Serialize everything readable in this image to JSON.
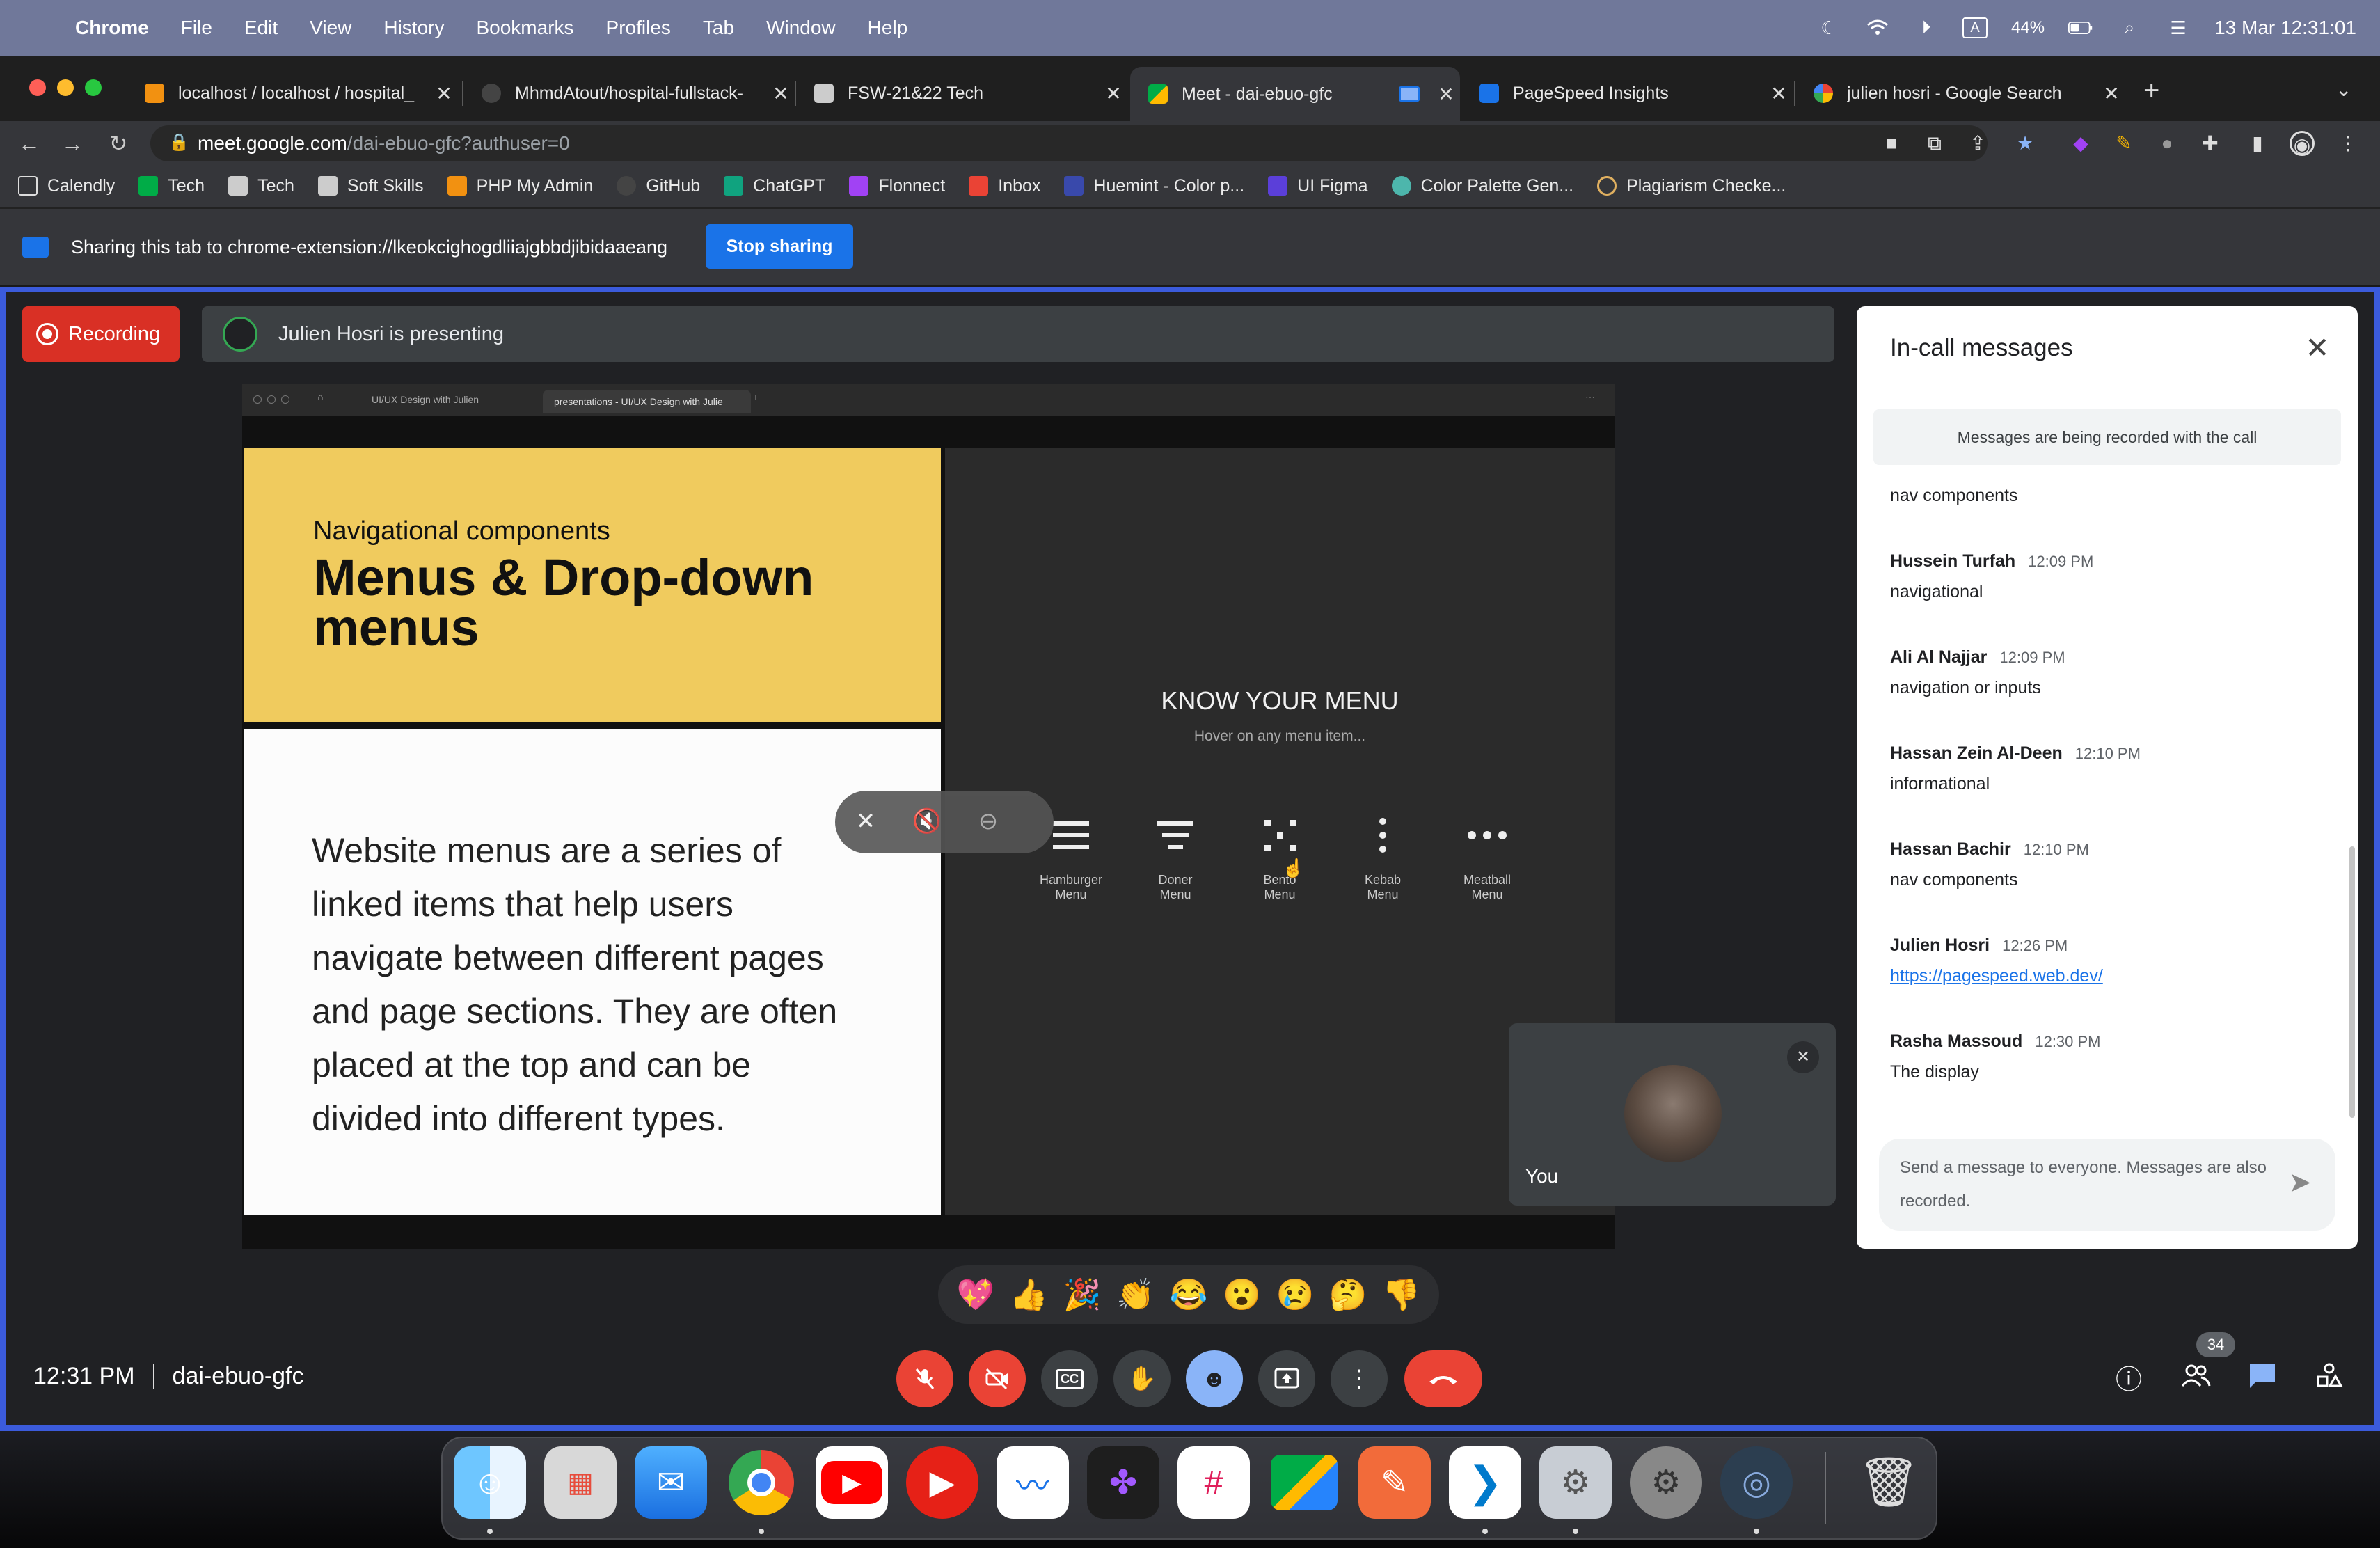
{
  "menubar": {
    "app": "Chrome",
    "items": [
      "File",
      "Edit",
      "View",
      "History",
      "Bookmarks",
      "Profiles",
      "Tab",
      "Window",
      "Help"
    ],
    "battery": "44%",
    "datetime": "13 Mar  12:31:01"
  },
  "tabs": [
    {
      "title": "localhost / localhost / hospital_"
    },
    {
      "title": "MhmdAtout/hospital-fullstack-"
    },
    {
      "title": "FSW-21&22 Tech"
    },
    {
      "title": "Meet - dai-ebuo-gfc"
    },
    {
      "title": "PageSpeed Insights"
    },
    {
      "title": "julien hosri - Google Search"
    }
  ],
  "omnibox": {
    "host": "meet.google.com",
    "path": "/dai-ebuo-gfc?authuser=0"
  },
  "bookmarks": [
    "Calendly",
    "Tech",
    "Tech",
    "Soft Skills",
    "PHP My Admin",
    "GitHub",
    "ChatGPT",
    "Flonnect",
    "Inbox",
    "Huemint - Color p...",
    "UI Figma",
    "Color Palette Gen...",
    "Plagiarism Checke..."
  ],
  "sharebar": {
    "text": "Sharing this tab to chrome-extension://lkeokcighogdliiajgbbdjibidaaeang",
    "stop": "Stop sharing"
  },
  "meet": {
    "recording": "Recording",
    "presenting": "Julien Hosri is presenting",
    "time": "12:31 PM",
    "code": "dai-ebuo-gfc",
    "self_label": "You",
    "participants": "34"
  },
  "slide": {
    "inner_tabs": [
      "UI/UX Design with Julien",
      "presentations - UI/UX Design with Julie"
    ],
    "kicker": "Navigational components",
    "title": "Menus & Drop-down menus",
    "body": "Website menus are a series of linked items that help users navigate between different pages and page sections. They are often placed at the top and can be divided into different types.",
    "panel_title": "KNOW YOUR MENU",
    "panel_hint": "Hover on any menu item...",
    "menus": [
      {
        "line1": "Hamburger",
        "line2": "Menu",
        "icon": "hamburger-icon"
      },
      {
        "line1": "Doner",
        "line2": "Menu",
        "icon": "doner-icon"
      },
      {
        "line1": "Bento",
        "line2": "Menu",
        "icon": "bento-icon"
      },
      {
        "line1": "Kebab",
        "line2": "Menu",
        "icon": "kebab-icon"
      },
      {
        "line1": "Meatball",
        "line2": "Menu",
        "icon": "meatball-icon"
      }
    ]
  },
  "chat": {
    "title": "In-call messages",
    "notice": "Messages are being recorded with the call",
    "first_line": "nav components",
    "messages": [
      {
        "sender": "Hussein Turfah",
        "time": "12:09 PM",
        "text": "navigational"
      },
      {
        "sender": "Ali Al Najjar",
        "time": "12:09 PM",
        "text": "navigation or inputs"
      },
      {
        "sender": "Hassan Zein Al-Deen",
        "time": "12:10 PM",
        "text": "informational"
      },
      {
        "sender": "Hassan Bachir",
        "time": "12:10 PM",
        "text": "nav components"
      },
      {
        "sender": "Julien Hosri",
        "time": "12:26 PM",
        "text": "https://pagespeed.web.dev/"
      },
      {
        "sender": "Rasha Massoud",
        "time": "12:30 PM",
        "text": "The display"
      }
    ],
    "input_placeholder": "Send a message to everyone. Messages are also recorded."
  },
  "colors": {
    "accent": "#1a73e8",
    "recording": "#d93025",
    "slide_yellow": "#f0cb5e",
    "meet_border": "#3b5bdb"
  }
}
